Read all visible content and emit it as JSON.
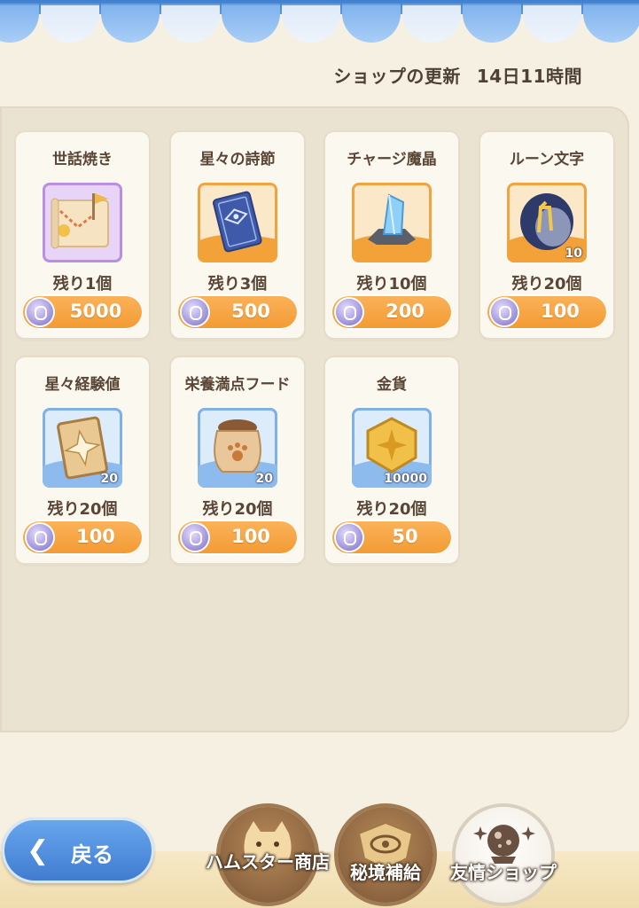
{
  "header": {
    "refresh_label": "ショップの更新",
    "refresh_time": "14日11時間"
  },
  "items": [
    {
      "name": "世話焼き",
      "icon": "treasure-map-icon",
      "qty_badge": "",
      "remaining": "残り1個",
      "price": "5000"
    },
    {
      "name": "星々の詩節",
      "icon": "rune-card-icon",
      "qty_badge": "",
      "remaining": "残り3個",
      "price": "500"
    },
    {
      "name": "チャージ魔晶",
      "icon": "crystal-icon",
      "qty_badge": "",
      "remaining": "残り10個",
      "price": "200"
    },
    {
      "name": "ルーン文字",
      "icon": "rune-stone-icon",
      "qty_badge": "10",
      "remaining": "残り20個",
      "price": "100"
    },
    {
      "name": "星々経験値",
      "icon": "star-card-icon",
      "qty_badge": "20",
      "remaining": "残り20個",
      "price": "100"
    },
    {
      "name": "栄養満点フード",
      "icon": "food-bag-icon",
      "qty_badge": "20",
      "remaining": "残り20個",
      "price": "100"
    },
    {
      "name": "金貨",
      "icon": "gold-coin-icon",
      "qty_badge": "10000",
      "remaining": "残り20個",
      "price": "50"
    }
  ],
  "nav": {
    "back_label": "戻る",
    "tabs": [
      "ハムスター商店",
      "秘境補給",
      "友情ショップ"
    ]
  },
  "colors": {
    "price_button": "#f39a33",
    "awning_blue": "#5d98e0",
    "currency_coin": "#9a8fd8"
  }
}
